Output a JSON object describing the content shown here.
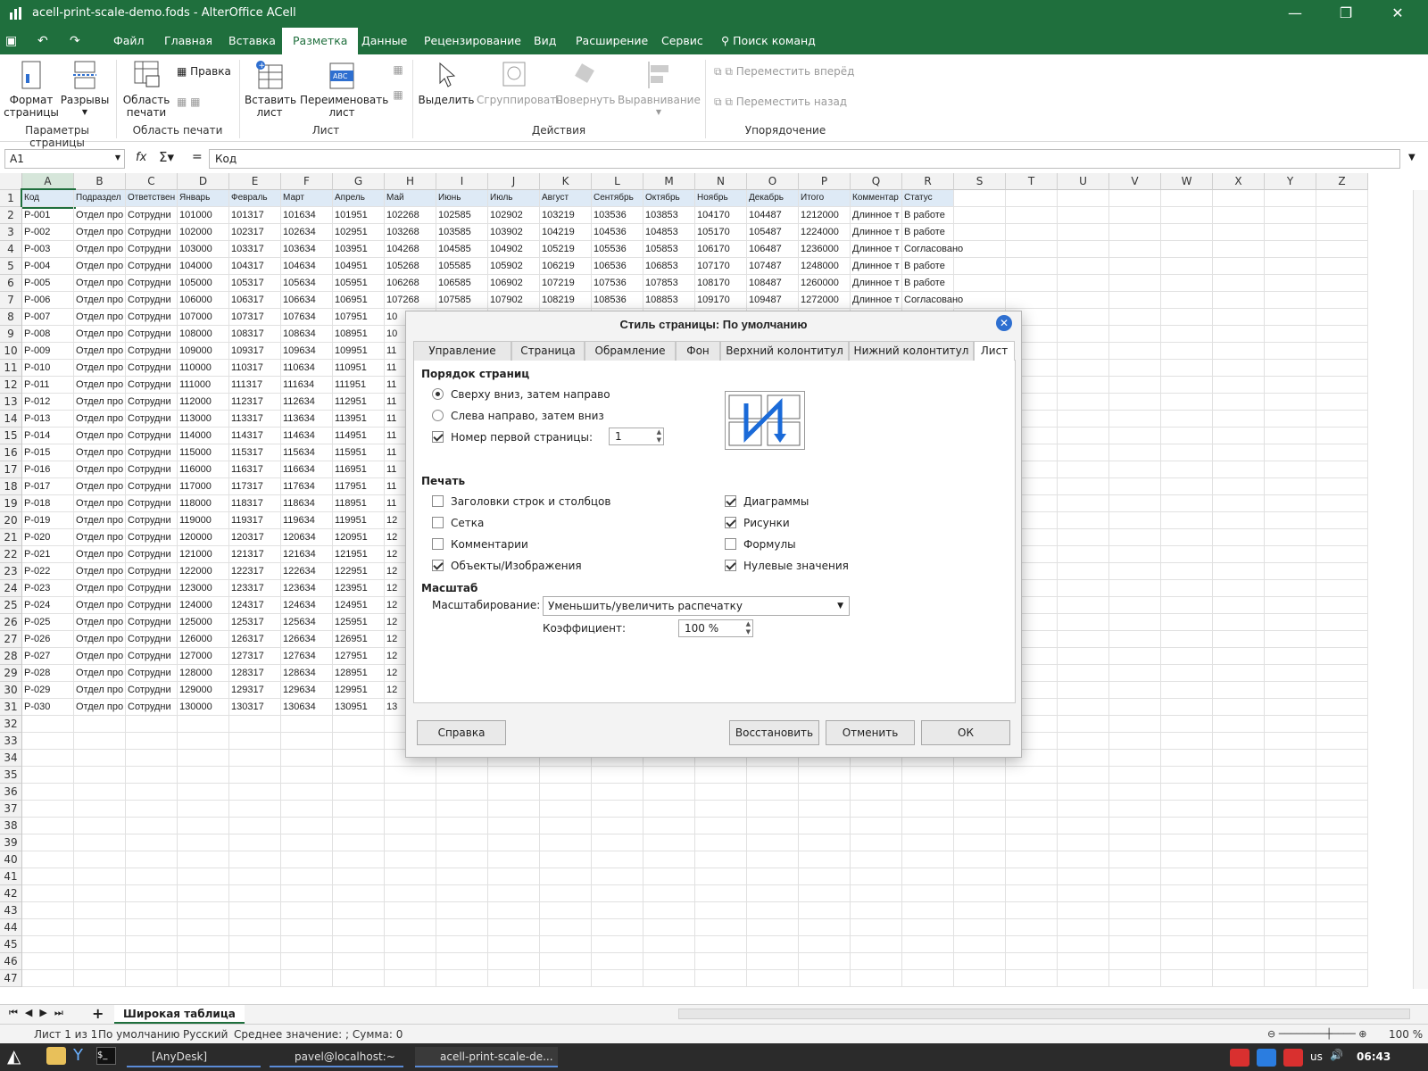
{
  "window": {
    "title": "acell-print-scale-demo.fods - AlterOffice ACell"
  },
  "menu": [
    "Файл",
    "Главная",
    "Вставка",
    "Разметка",
    "Данные",
    "Рецензирование",
    "Вид",
    "Расширение",
    "Сервис"
  ],
  "menu_search": "Поиск команд",
  "ribbon": {
    "format_page": "Формат\nстраницы",
    "breaks": "Разрывы",
    "print_area": "Область\nпечати",
    "edit": "Правка",
    "insert_sheet": "Вставить\nлист",
    "rename_sheet": "Переименовать\nлист",
    "select": "Выделить",
    "group": "Сгруппировать",
    "rotate": "Повернуть",
    "align": "Выравнивание",
    "bring_forward": "Переместить вперёд",
    "send_backward": "Переместить назад",
    "groups": {
      "page_params": "Параметры страницы",
      "print_area": "Область печати",
      "sheet": "Лист",
      "actions": "Действия",
      "arrange": "Упорядочение"
    }
  },
  "formula": {
    "namebox": "A1",
    "fx": "fx",
    "value": "Код"
  },
  "columns": [
    "A",
    "B",
    "C",
    "D",
    "E",
    "F",
    "G",
    "H",
    "I",
    "J",
    "K",
    "L",
    "M",
    "N",
    "O",
    "P",
    "Q",
    "R",
    "S",
    "T",
    "U",
    "V",
    "W",
    "X",
    "Y",
    "Z"
  ],
  "header_row": [
    "Код",
    "Подраздел",
    "Ответствен",
    "Январь",
    "Февраль",
    "Март",
    "Апрель",
    "Май",
    "Июнь",
    "Июль",
    "Август",
    "Сентябрь",
    "Октябрь",
    "Ноябрь",
    "Декабрь",
    "Итого",
    "Комментар",
    "Статус"
  ],
  "rows": [
    [
      "P-001",
      "Отдел про",
      "Сотрудни",
      "101000",
      "101317",
      "101634",
      "101951",
      "102268",
      "102585",
      "102902",
      "103219",
      "103536",
      "103853",
      "104170",
      "104487",
      "1212000",
      "Длинное т",
      "В работе"
    ],
    [
      "P-002",
      "Отдел про",
      "Сотрудни",
      "102000",
      "102317",
      "102634",
      "102951",
      "103268",
      "103585",
      "103902",
      "104219",
      "104536",
      "104853",
      "105170",
      "105487",
      "1224000",
      "Длинное т",
      "В работе"
    ],
    [
      "P-003",
      "Отдел про",
      "Сотрудни",
      "103000",
      "103317",
      "103634",
      "103951",
      "104268",
      "104585",
      "104902",
      "105219",
      "105536",
      "105853",
      "106170",
      "106487",
      "1236000",
      "Длинное т",
      "Согласовано"
    ],
    [
      "P-004",
      "Отдел про",
      "Сотрудни",
      "104000",
      "104317",
      "104634",
      "104951",
      "105268",
      "105585",
      "105902",
      "106219",
      "106536",
      "106853",
      "107170",
      "107487",
      "1248000",
      "Длинное т",
      "В работе"
    ],
    [
      "P-005",
      "Отдел про",
      "Сотрудни",
      "105000",
      "105317",
      "105634",
      "105951",
      "106268",
      "106585",
      "106902",
      "107219",
      "107536",
      "107853",
      "108170",
      "108487",
      "1260000",
      "Длинное т",
      "В работе"
    ],
    [
      "P-006",
      "Отдел про",
      "Сотрудни",
      "106000",
      "106317",
      "106634",
      "106951",
      "107268",
      "107585",
      "107902",
      "108219",
      "108536",
      "108853",
      "109170",
      "109487",
      "1272000",
      "Длинное т",
      "Согласовано"
    ],
    [
      "P-007",
      "Отдел про",
      "Сотрудни",
      "107000",
      "107317",
      "107634",
      "107951",
      "10"
    ],
    [
      "P-008",
      "Отдел про",
      "Сотрудни",
      "108000",
      "108317",
      "108634",
      "108951",
      "10"
    ],
    [
      "P-009",
      "Отдел про",
      "Сотрудни",
      "109000",
      "109317",
      "109634",
      "109951",
      "11"
    ],
    [
      "P-010",
      "Отдел про",
      "Сотрудни",
      "110000",
      "110317",
      "110634",
      "110951",
      "11"
    ],
    [
      "P-011",
      "Отдел про",
      "Сотрудни",
      "111000",
      "111317",
      "111634",
      "111951",
      "11"
    ],
    [
      "P-012",
      "Отдел про",
      "Сотрудни",
      "112000",
      "112317",
      "112634",
      "112951",
      "11"
    ],
    [
      "P-013",
      "Отдел про",
      "Сотрудни",
      "113000",
      "113317",
      "113634",
      "113951",
      "11"
    ],
    [
      "P-014",
      "Отдел про",
      "Сотрудни",
      "114000",
      "114317",
      "114634",
      "114951",
      "11"
    ],
    [
      "P-015",
      "Отдел про",
      "Сотрудни",
      "115000",
      "115317",
      "115634",
      "115951",
      "11"
    ],
    [
      "P-016",
      "Отдел про",
      "Сотрудни",
      "116000",
      "116317",
      "116634",
      "116951",
      "11"
    ],
    [
      "P-017",
      "Отдел про",
      "Сотрудни",
      "117000",
      "117317",
      "117634",
      "117951",
      "11"
    ],
    [
      "P-018",
      "Отдел про",
      "Сотрудни",
      "118000",
      "118317",
      "118634",
      "118951",
      "11"
    ],
    [
      "P-019",
      "Отдел про",
      "Сотрудни",
      "119000",
      "119317",
      "119634",
      "119951",
      "12"
    ],
    [
      "P-020",
      "Отдел про",
      "Сотрудни",
      "120000",
      "120317",
      "120634",
      "120951",
      "12"
    ],
    [
      "P-021",
      "Отдел про",
      "Сотрудни",
      "121000",
      "121317",
      "121634",
      "121951",
      "12"
    ],
    [
      "P-022",
      "Отдел про",
      "Сотрудни",
      "122000",
      "122317",
      "122634",
      "122951",
      "12"
    ],
    [
      "P-023",
      "Отдел про",
      "Сотрудни",
      "123000",
      "123317",
      "123634",
      "123951",
      "12"
    ],
    [
      "P-024",
      "Отдел про",
      "Сотрудни",
      "124000",
      "124317",
      "124634",
      "124951",
      "12"
    ],
    [
      "P-025",
      "Отдел про",
      "Сотрудни",
      "125000",
      "125317",
      "125634",
      "125951",
      "12"
    ],
    [
      "P-026",
      "Отдел про",
      "Сотрудни",
      "126000",
      "126317",
      "126634",
      "126951",
      "12"
    ],
    [
      "P-027",
      "Отдел про",
      "Сотрудни",
      "127000",
      "127317",
      "127634",
      "127951",
      "12"
    ],
    [
      "P-028",
      "Отдел про",
      "Сотрудни",
      "128000",
      "128317",
      "128634",
      "128951",
      "12"
    ],
    [
      "P-029",
      "Отдел про",
      "Сотрудни",
      "129000",
      "129317",
      "129634",
      "129951",
      "12"
    ],
    [
      "P-030",
      "Отдел про",
      "Сотрудни",
      "130000",
      "130317",
      "130634",
      "130951",
      "13"
    ]
  ],
  "row_count": 47,
  "dialog": {
    "title": "Стиль страницы: По умолчанию",
    "tabs": [
      "Управление",
      "Страница",
      "Обрамление",
      "Фон",
      "Верхний колонтитул",
      "Нижний колонтитул",
      "Лист"
    ],
    "page_order": "Порядок страниц",
    "top_down": "Сверху вниз, затем направо",
    "left_right": "Слева направо, затем вниз",
    "first_page_num": "Номер первой страницы:",
    "first_page_value": "1",
    "print": "Печать",
    "headers": "Заголовки строк и столбцов",
    "grid": "Сетка",
    "comments": "Комментарии",
    "objects": "Объекты/Изображения",
    "charts": "Диаграммы",
    "drawings": "Рисунки",
    "formulas": "Формулы",
    "zero_values": "Нулевые значения",
    "scale": "Масштаб",
    "scaling": "Масштабирование:",
    "scaling_mode": "Уменьшить/увеличить распечатку",
    "factor": "Коэффициент:",
    "factor_value": "100 %",
    "help": "Справка",
    "reset": "Восстановить",
    "cancel": "Отменить",
    "ok": "ОК"
  },
  "sheet_tab": "Широкая таблица",
  "status": {
    "sheet": "Лист 1 из 1",
    "style": "По умолчанию",
    "lang": "Русский",
    "summary": "Среднее значение: ; Сумма: 0",
    "zoom": "100 %"
  },
  "taskbar": {
    "anydesk": "[AnyDesk]",
    "terminal": "pavel@localhost:~",
    "acell": "acell-print-scale-de...",
    "layout": "us",
    "time": "06:43"
  }
}
